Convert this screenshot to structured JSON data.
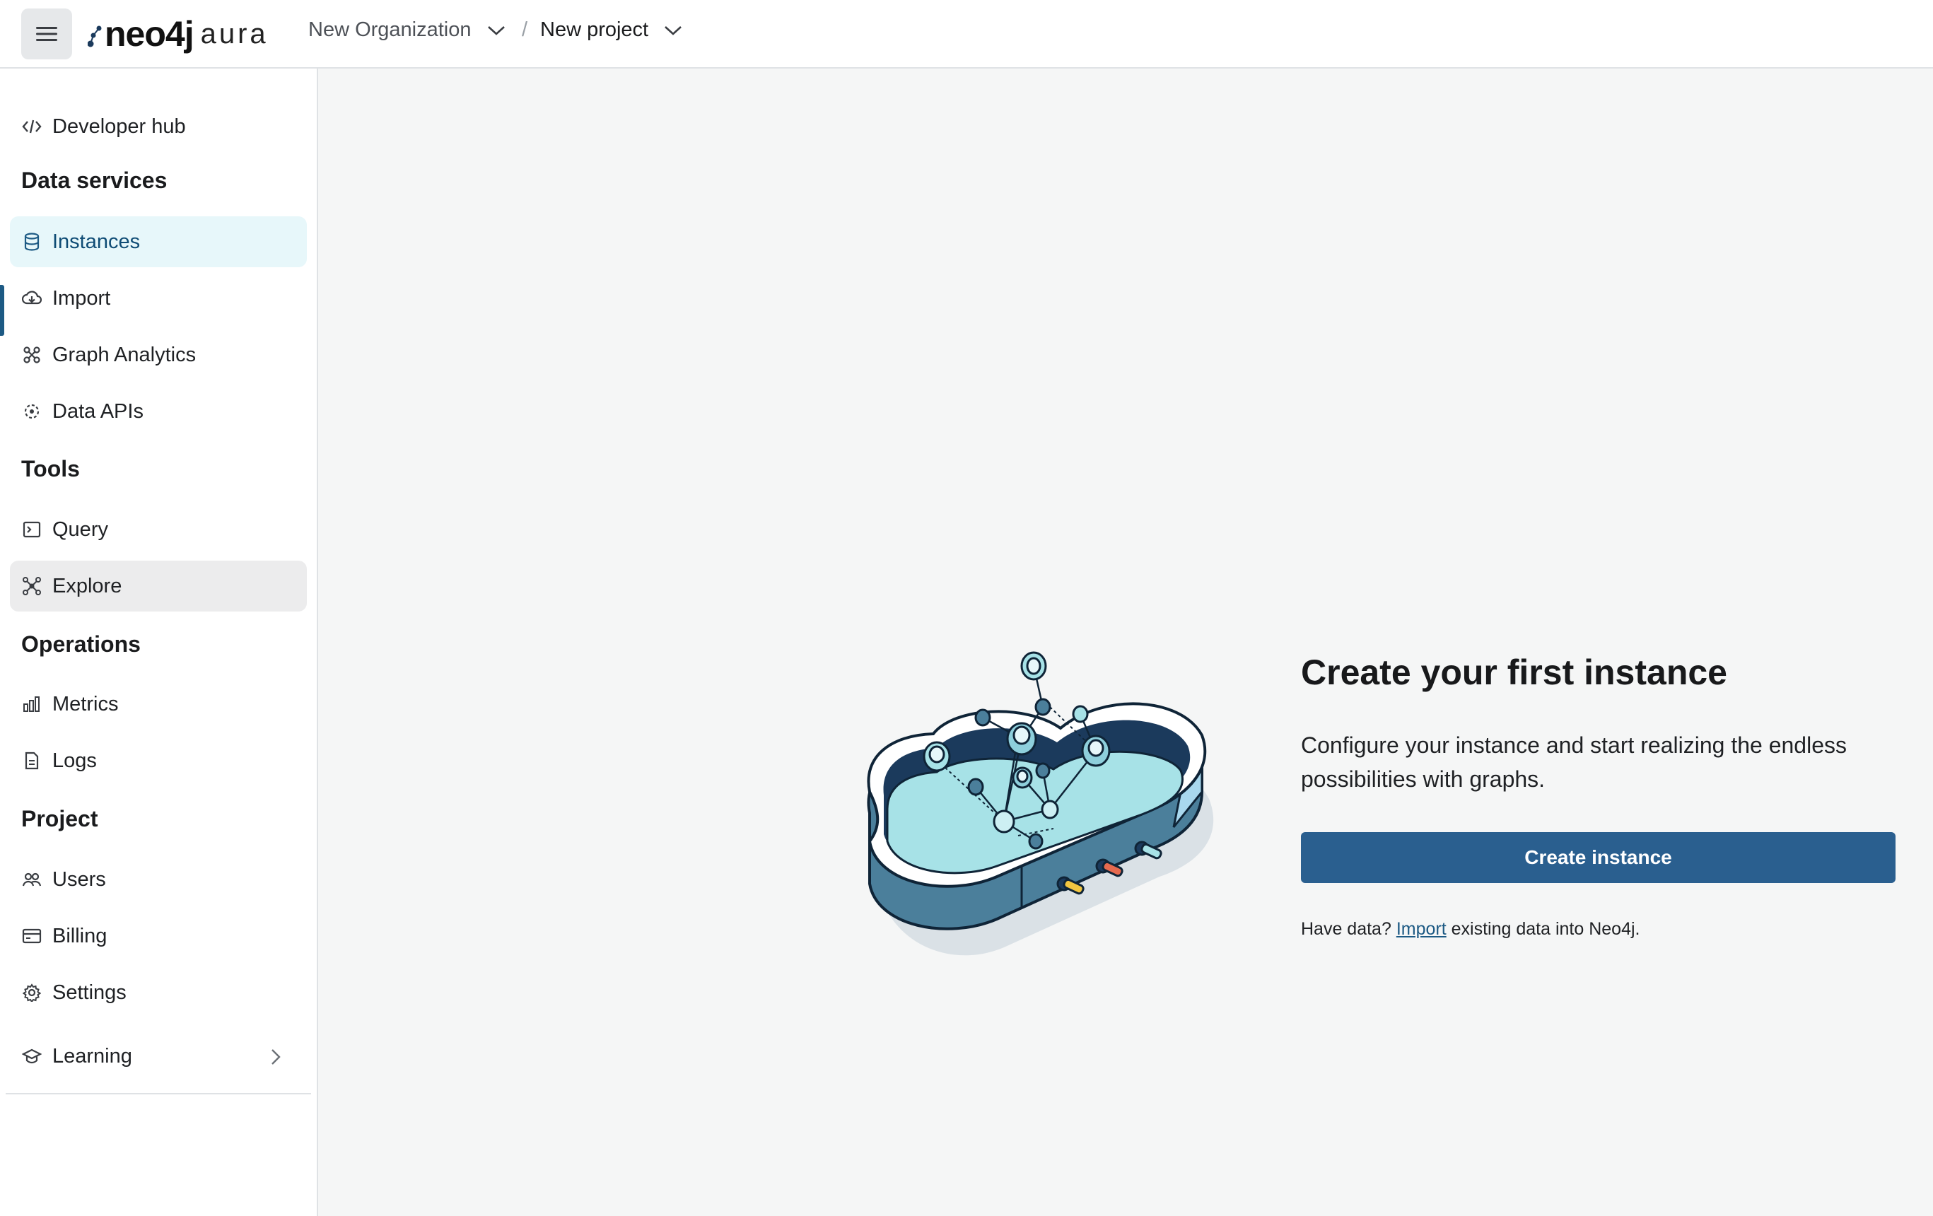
{
  "header": {
    "logo_main": "neo4j",
    "logo_sub": "aura",
    "org_name": "New Organization",
    "separator": "/",
    "project_name": "New project"
  },
  "sidebar": {
    "developer_hub": "Developer hub",
    "sections": {
      "data_services": "Data services",
      "tools": "Tools",
      "operations": "Operations",
      "project": "Project"
    },
    "items": {
      "instances": "Instances",
      "import": "Import",
      "graph_analytics": "Graph Analytics",
      "data_apis": "Data APIs",
      "query": "Query",
      "explore": "Explore",
      "metrics": "Metrics",
      "logs": "Logs",
      "users": "Users",
      "billing": "Billing",
      "settings": "Settings",
      "learning": "Learning"
    },
    "active_item": "Instances"
  },
  "main": {
    "title": "Create your first instance",
    "description": "Configure your instance and start realizing the endless possibilities with graphs.",
    "button": "Create instance",
    "note_prefix": "Have data?",
    "note_link": "Import",
    "note_suffix": "existing data into Neo4j."
  },
  "colors": {
    "accent": "#2a5f8f",
    "active_bg": "#e7f7fa",
    "active_bar": "#1d5a84"
  }
}
